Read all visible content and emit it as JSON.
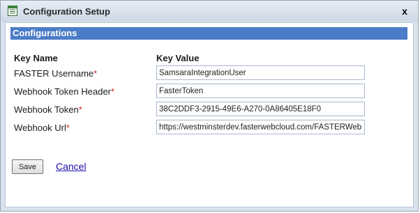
{
  "window": {
    "title": "Configuration Setup",
    "icon": "list-document-icon",
    "close_label": "x"
  },
  "section": {
    "title": "Configurations"
  },
  "columns": {
    "key_name": "Key Name",
    "key_value": "Key Value"
  },
  "rows": [
    {
      "label": "FASTER Username",
      "required": "*",
      "value": "SamsaraIntegrationUser"
    },
    {
      "label": "Webhook Token Header",
      "required": "*",
      "value": "FasterToken"
    },
    {
      "label": "Webhook Token",
      "required": "*",
      "value": "38C2DDF3-2915-49E6-A270-0A86405E18F0"
    },
    {
      "label": "Webhook Url",
      "required": "*",
      "value": "https://westminsterdev.fasterwebcloud.com/FASTERWeb"
    }
  ],
  "actions": {
    "save_label": "Save",
    "cancel_label": "Cancel"
  },
  "colors": {
    "section_header_bg": "#4a7cc7",
    "required_marker": "#d22424",
    "link": "#1a0dab"
  }
}
